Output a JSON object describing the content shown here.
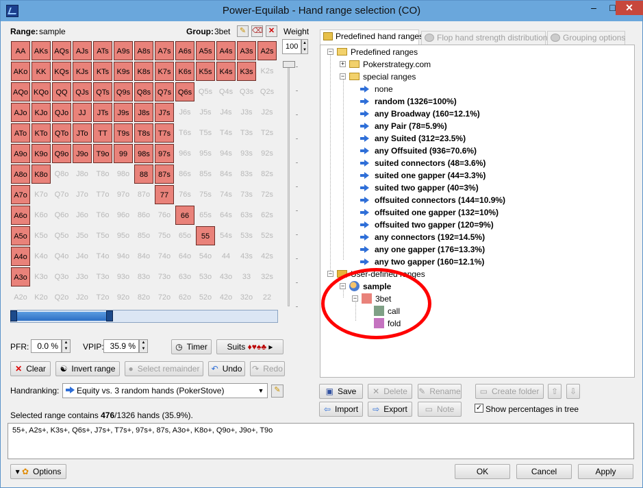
{
  "window": {
    "title": "Power-Equilab - Hand range selection (CO)",
    "min": "–",
    "max": "□",
    "close": "✕"
  },
  "range_label": "Range:",
  "range_name": "sample",
  "group_label": "Group:",
  "group_name": "3bet",
  "weight_label": "Weight",
  "weight_value": "100",
  "grid": {
    "rows": [
      [
        [
          "AA",
          1
        ],
        [
          "AKs",
          1
        ],
        [
          "AQs",
          1
        ],
        [
          "AJs",
          1
        ],
        [
          "ATs",
          1
        ],
        [
          "A9s",
          1
        ],
        [
          "A8s",
          1
        ],
        [
          "A7s",
          1
        ],
        [
          "A6s",
          1
        ],
        [
          "A5s",
          1
        ],
        [
          "A4s",
          1
        ],
        [
          "A3s",
          1
        ],
        [
          "A2s",
          1
        ]
      ],
      [
        [
          "AKo",
          1
        ],
        [
          "KK",
          1
        ],
        [
          "KQs",
          1
        ],
        [
          "KJs",
          1
        ],
        [
          "KTs",
          1
        ],
        [
          "K9s",
          1
        ],
        [
          "K8s",
          1
        ],
        [
          "K7s",
          1
        ],
        [
          "K6s",
          1
        ],
        [
          "K5s",
          1
        ],
        [
          "K4s",
          1
        ],
        [
          "K3s",
          1
        ],
        [
          "K2s",
          0
        ]
      ],
      [
        [
          "AQo",
          1
        ],
        [
          "KQo",
          1
        ],
        [
          "QQ",
          1
        ],
        [
          "QJs",
          1
        ],
        [
          "QTs",
          1
        ],
        [
          "Q9s",
          1
        ],
        [
          "Q8s",
          1
        ],
        [
          "Q7s",
          1
        ],
        [
          "Q6s",
          1
        ],
        [
          "Q5s",
          0
        ],
        [
          "Q4s",
          0
        ],
        [
          "Q3s",
          0
        ],
        [
          "Q2s",
          0
        ]
      ],
      [
        [
          "AJo",
          1
        ],
        [
          "KJo",
          1
        ],
        [
          "QJo",
          1
        ],
        [
          "JJ",
          1
        ],
        [
          "JTs",
          1
        ],
        [
          "J9s",
          1
        ],
        [
          "J8s",
          1
        ],
        [
          "J7s",
          1
        ],
        [
          "J6s",
          0
        ],
        [
          "J5s",
          0
        ],
        [
          "J4s",
          0
        ],
        [
          "J3s",
          0
        ],
        [
          "J2s",
          0
        ]
      ],
      [
        [
          "ATo",
          1
        ],
        [
          "KTo",
          1
        ],
        [
          "QTo",
          1
        ],
        [
          "JTo",
          1
        ],
        [
          "TT",
          1
        ],
        [
          "T9s",
          1
        ],
        [
          "T8s",
          1
        ],
        [
          "T7s",
          1
        ],
        [
          "T6s",
          0
        ],
        [
          "T5s",
          0
        ],
        [
          "T4s",
          0
        ],
        [
          "T3s",
          0
        ],
        [
          "T2s",
          0
        ]
      ],
      [
        [
          "A9o",
          1
        ],
        [
          "K9o",
          1
        ],
        [
          "Q9o",
          1
        ],
        [
          "J9o",
          1
        ],
        [
          "T9o",
          1
        ],
        [
          "99",
          1
        ],
        [
          "98s",
          1
        ],
        [
          "97s",
          1
        ],
        [
          "96s",
          0
        ],
        [
          "95s",
          0
        ],
        [
          "94s",
          0
        ],
        [
          "93s",
          0
        ],
        [
          "92s",
          0
        ]
      ],
      [
        [
          "A8o",
          1
        ],
        [
          "K8o",
          1
        ],
        [
          "Q8o",
          0
        ],
        [
          "J8o",
          0
        ],
        [
          "T8o",
          0
        ],
        [
          "98o",
          0
        ],
        [
          "88",
          1
        ],
        [
          "87s",
          1
        ],
        [
          "86s",
          0
        ],
        [
          "85s",
          0
        ],
        [
          "84s",
          0
        ],
        [
          "83s",
          0
        ],
        [
          "82s",
          0
        ]
      ],
      [
        [
          "A7o",
          1
        ],
        [
          "K7o",
          0
        ],
        [
          "Q7o",
          0
        ],
        [
          "J7o",
          0
        ],
        [
          "T7o",
          0
        ],
        [
          "97o",
          0
        ],
        [
          "87o",
          0
        ],
        [
          "77",
          1
        ],
        [
          "76s",
          0
        ],
        [
          "75s",
          0
        ],
        [
          "74s",
          0
        ],
        [
          "73s",
          0
        ],
        [
          "72s",
          0
        ]
      ],
      [
        [
          "A6o",
          1
        ],
        [
          "K6o",
          0
        ],
        [
          "Q6o",
          0
        ],
        [
          "J6o",
          0
        ],
        [
          "T6o",
          0
        ],
        [
          "96o",
          0
        ],
        [
          "86o",
          0
        ],
        [
          "76o",
          0
        ],
        [
          "66",
          1
        ],
        [
          "65s",
          0
        ],
        [
          "64s",
          0
        ],
        [
          "63s",
          0
        ],
        [
          "62s",
          0
        ]
      ],
      [
        [
          "A5o",
          1
        ],
        [
          "K5o",
          0
        ],
        [
          "Q5o",
          0
        ],
        [
          "J5o",
          0
        ],
        [
          "T5o",
          0
        ],
        [
          "95o",
          0
        ],
        [
          "85o",
          0
        ],
        [
          "75o",
          0
        ],
        [
          "65o",
          0
        ],
        [
          "55",
          1
        ],
        [
          "54s",
          0
        ],
        [
          "53s",
          0
        ],
        [
          "52s",
          0
        ]
      ],
      [
        [
          "A4o",
          1
        ],
        [
          "K4o",
          0
        ],
        [
          "Q4o",
          0
        ],
        [
          "J4o",
          0
        ],
        [
          "T4o",
          0
        ],
        [
          "94o",
          0
        ],
        [
          "84o",
          0
        ],
        [
          "74o",
          0
        ],
        [
          "64o",
          0
        ],
        [
          "54o",
          0
        ],
        [
          "44",
          0
        ],
        [
          "43s",
          0
        ],
        [
          "42s",
          0
        ]
      ],
      [
        [
          "A3o",
          1
        ],
        [
          "K3o",
          0
        ],
        [
          "Q3o",
          0
        ],
        [
          "J3o",
          0
        ],
        [
          "T3o",
          0
        ],
        [
          "93o",
          0
        ],
        [
          "83o",
          0
        ],
        [
          "73o",
          0
        ],
        [
          "63o",
          0
        ],
        [
          "53o",
          0
        ],
        [
          "43o",
          0
        ],
        [
          "33",
          0
        ],
        [
          "32s",
          0
        ]
      ],
      [
        [
          "A2o",
          0
        ],
        [
          "K2o",
          0
        ],
        [
          "Q2o",
          0
        ],
        [
          "J2o",
          0
        ],
        [
          "T2o",
          0
        ],
        [
          "92o",
          0
        ],
        [
          "82o",
          0
        ],
        [
          "72o",
          0
        ],
        [
          "62o",
          0
        ],
        [
          "52o",
          0
        ],
        [
          "42o",
          0
        ],
        [
          "32o",
          0
        ],
        [
          "22",
          0
        ]
      ]
    ]
  },
  "range_slider_percent": 35.9,
  "pfr_label": "PFR:",
  "pfr_value": "0.0 %",
  "vpip_label": "VPIP:",
  "vpip_value": "35.9 %",
  "timer_label": "Timer",
  "suits_label": "Suits",
  "suits_glyphs": "♦♥♠♣",
  "buttons": {
    "clear": "Clear",
    "invert": "Invert range",
    "select_remainder": "Select remainder",
    "undo": "Undo",
    "redo": "Redo"
  },
  "handranking_label": "Handranking:",
  "handranking_value": "Equity vs. 3 random hands (PokerStove)",
  "selected_text_prefix": "Selected range contains ",
  "selected_count": "476",
  "selected_text_suffix": "/1326 hands (35.9%).",
  "range_string": "55+, A2s+, K3s+, Q6s+, J7s+, T7s+, 97s+, 87s, A3o+, K8o+, Q9o+, J9o+, T9o",
  "tabs": [
    "Predefined hand ranges",
    "Flop hand strength distribution",
    "Grouping options"
  ],
  "tree": {
    "root": "Predefined ranges",
    "pokerstrategy": "Pokerstrategy.com",
    "special": "special ranges",
    "items": [
      "none",
      "random (1326=100%)",
      "any Broadway (160=12.1%)",
      "any Pair (78=5.9%)",
      "any Suited (312=23.5%)",
      "any Offsuited (936=70.6%)",
      "suited connectors (48=3.6%)",
      "suited one gapper (44=3.3%)",
      "suited two gapper (40=3%)",
      "offsuited connectors (144=10.9%)",
      "offsuited one gapper (132=10%)",
      "offsuited two gapper (120=9%)",
      "any connectors (192=14.5%)",
      "any one gapper (176=13.3%)",
      "any two gapper (160=12.1%)"
    ],
    "user_defined": "User-defined ranges",
    "sample": "sample",
    "groups": [
      {
        "name": "3bet",
        "color": "#e9827a"
      },
      {
        "name": "call",
        "color": "#7fa086"
      },
      {
        "name": "fold",
        "color": "#c573c0"
      }
    ]
  },
  "tree_buttons": {
    "save": "Save",
    "delete": "Delete",
    "rename": "Rename",
    "create_folder": "Create folder",
    "import": "Import",
    "export": "Export",
    "note": "Note"
  },
  "show_percentages_label": "Show percentages in tree",
  "show_percentages_checked": true,
  "options_label": "Options",
  "ok": "OK",
  "cancel": "Cancel",
  "apply": "Apply"
}
